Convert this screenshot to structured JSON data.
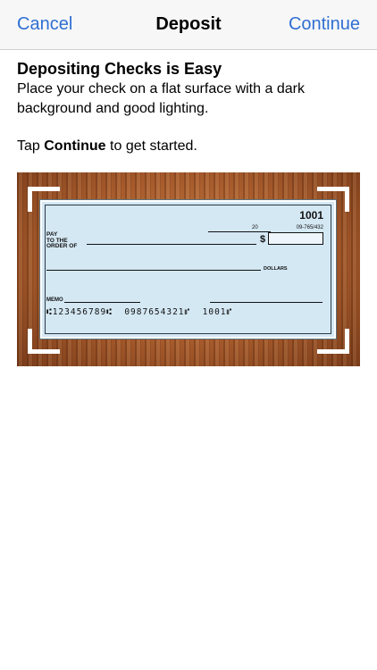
{
  "navbar": {
    "cancel_label": "Cancel",
    "title": "Deposit",
    "continue_label": "Continue"
  },
  "content": {
    "heading": "Depositing Checks is Easy",
    "description": "Place your check on a flat surface with a dark background and good lighting.",
    "tap_prefix": "Tap ",
    "tap_bold": "Continue",
    "tap_suffix": " to get started."
  },
  "check": {
    "number": "1001",
    "routing_small": "09-765/432",
    "date_year": "20",
    "pay_line1": "PAY",
    "pay_line2": "TO THE",
    "pay_line3": "ORDER OF",
    "dollar_sign": "$",
    "dollars_label": "DOLLARS",
    "memo_label": "MEMO",
    "micr": "⑆123456789⑆  0987654321⑈  1001⑈"
  },
  "colors": {
    "accent": "#2f6fd1",
    "check_paper": "#d4e8f4",
    "wood": "#a65a2b"
  }
}
